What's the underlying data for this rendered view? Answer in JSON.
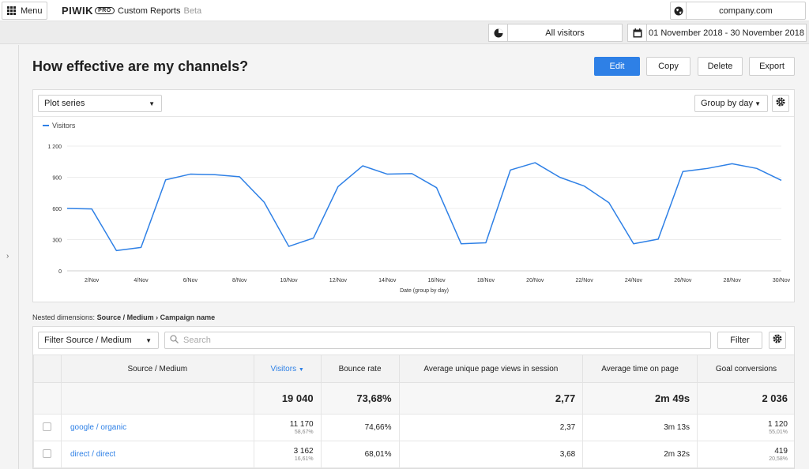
{
  "topbar": {
    "menu_label": "Menu",
    "logo_text": "PIWIK",
    "logo_badge": "PRO",
    "app_name": "Custom Reports",
    "app_badge": "Beta",
    "website": "company.com"
  },
  "subbar": {
    "segment": "All visitors",
    "date_range": "01 November 2018 - 30 November 2018"
  },
  "page": {
    "title": "How effective are my channels?",
    "actions": {
      "edit": "Edit",
      "copy": "Copy",
      "delete": "Delete",
      "export": "Export"
    }
  },
  "chart_toolbar": {
    "series_select": "Plot series",
    "group_select": "Group by day"
  },
  "chart_data": {
    "type": "line",
    "xlabel": "Date (group by day)",
    "ylabel": "",
    "ylim": [
      0,
      1200
    ],
    "yticks": [
      "0",
      "300",
      "600",
      "900",
      "1 200"
    ],
    "ytick_values": [
      0,
      300,
      600,
      900,
      1200
    ],
    "x": [
      1,
      2,
      3,
      4,
      5,
      6,
      7,
      8,
      9,
      10,
      11,
      12,
      13,
      14,
      15,
      16,
      17,
      18,
      19,
      20,
      21,
      22,
      23,
      24,
      25,
      26,
      27,
      28,
      29,
      30
    ],
    "xtick_labels": [
      "2/Nov",
      "4/Nov",
      "6/Nov",
      "8/Nov",
      "10/Nov",
      "12/Nov",
      "14/Nov",
      "16/Nov",
      "18/Nov",
      "20/Nov",
      "22/Nov",
      "24/Nov",
      "26/Nov",
      "28/Nov",
      "30/Nov"
    ],
    "xtick_days": [
      2,
      4,
      6,
      8,
      10,
      12,
      14,
      16,
      18,
      20,
      22,
      24,
      26,
      28,
      30
    ],
    "series": [
      {
        "name": "Visitors",
        "color": "#2e80e6",
        "values": [
          600,
          595,
          195,
          225,
          875,
          930,
          925,
          905,
          660,
          235,
          315,
          810,
          1010,
          930,
          935,
          800,
          260,
          270,
          970,
          1040,
          900,
          815,
          655,
          260,
          305,
          955,
          985,
          1030,
          985,
          870
        ]
      }
    ],
    "grid": true,
    "legend": "top-left"
  },
  "table": {
    "nested_label": "Nested dimensions:",
    "nested_dims": "Source / Medium › Campaign name",
    "filter_select": "Filter Source / Medium",
    "search_placeholder": "Search",
    "filter_button": "Filter",
    "columns": [
      "Source / Medium",
      "Visitors",
      "Bounce rate",
      "Average unique page views in session",
      "Average time on page",
      "Goal conversions"
    ],
    "totals": [
      "",
      "19 040",
      "73,68%",
      "2,77",
      "2m 49s",
      "2 036"
    ],
    "rows": [
      {
        "dim": "google / organic",
        "visitors": "11 170",
        "visitors_pct": "58,67%",
        "bounce": "74,66%",
        "pages": "2,37",
        "time": "3m 13s",
        "goals": "1 120",
        "goals_pct": "55,01%"
      },
      {
        "dim": "direct / direct",
        "visitors": "3 162",
        "visitors_pct": "16,61%",
        "bounce": "68,01%",
        "pages": "3,68",
        "time": "2m 32s",
        "goals": "419",
        "goals_pct": "20,58%"
      }
    ]
  }
}
